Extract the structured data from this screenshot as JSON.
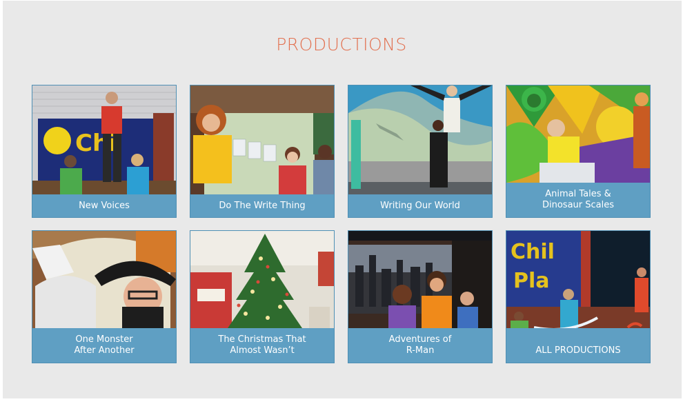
{
  "page": {
    "title": "PRODUCTIONS"
  },
  "productions": [
    {
      "label": "New Voices"
    },
    {
      "label": "Do The Write Thing"
    },
    {
      "label": "Writing Our World"
    },
    {
      "label": "Animal Tales &\nDinosaur Scales"
    },
    {
      "label": "One Monster\nAfter Another"
    },
    {
      "label": "The Christmas That\nAlmost Wasn’t"
    },
    {
      "label": "Adventures of\nR-Man"
    },
    {
      "label": "ALL PRODUCTIONS"
    }
  ],
  "colors": {
    "title": "#e2704f",
    "caption_bg": "#5f9fc3",
    "panel_bg": "#e9e9e9"
  }
}
